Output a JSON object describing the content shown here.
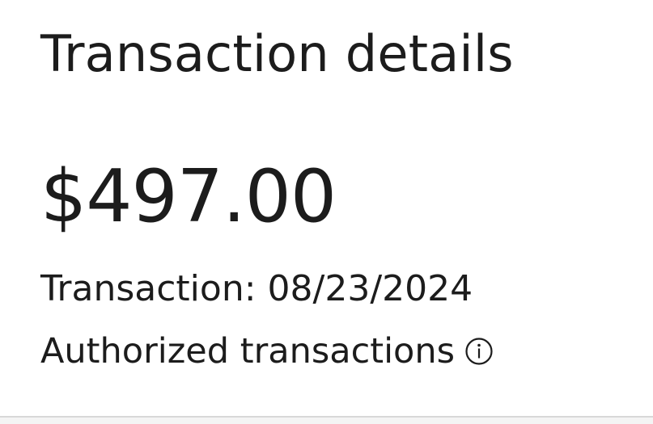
{
  "header": {
    "title": "Transaction details"
  },
  "transaction": {
    "amount": "$497.00",
    "date_text": "Transaction: 08/23/2024",
    "status": "Authorized transactions",
    "status_info_icon": "info-circle-icon"
  },
  "colors": {
    "text": "#1c1c1c",
    "background": "#ffffff",
    "divider": "#d8d8d8"
  }
}
